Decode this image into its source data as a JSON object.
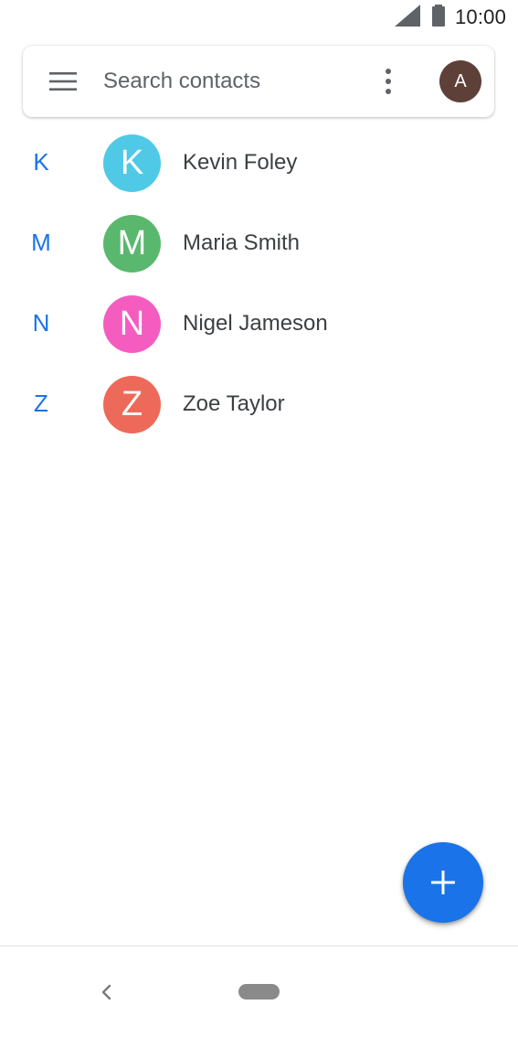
{
  "status_bar": {
    "time": "10:00",
    "icons": [
      "signal-icon",
      "battery-icon"
    ]
  },
  "search": {
    "placeholder": "Search contacts",
    "value": "",
    "menu_icon": "menu-icon",
    "more_icon": "more-vert-icon",
    "account_initial": "A",
    "account_color": "#5d4037"
  },
  "contacts": [
    {
      "section": "K",
      "initial": "K",
      "name": "Kevin Foley",
      "color": "#4fc9e6"
    },
    {
      "section": "M",
      "initial": "M",
      "name": "Maria Smith",
      "color": "#5ab86e"
    },
    {
      "section": "N",
      "initial": "N",
      "name": "Nigel Jameson",
      "color": "#f45cc0"
    },
    {
      "section": "Z",
      "initial": "Z",
      "name": "Zoe Taylor",
      "color": "#ed6a5a"
    }
  ],
  "fab": {
    "icon": "plus-icon",
    "color": "#1a73e8"
  },
  "nav_bar": {
    "back_icon": "back-chevron-icon",
    "home_icon": "home-pill-icon"
  },
  "colors": {
    "accent": "#1a73e8",
    "text": "#3c4043"
  }
}
